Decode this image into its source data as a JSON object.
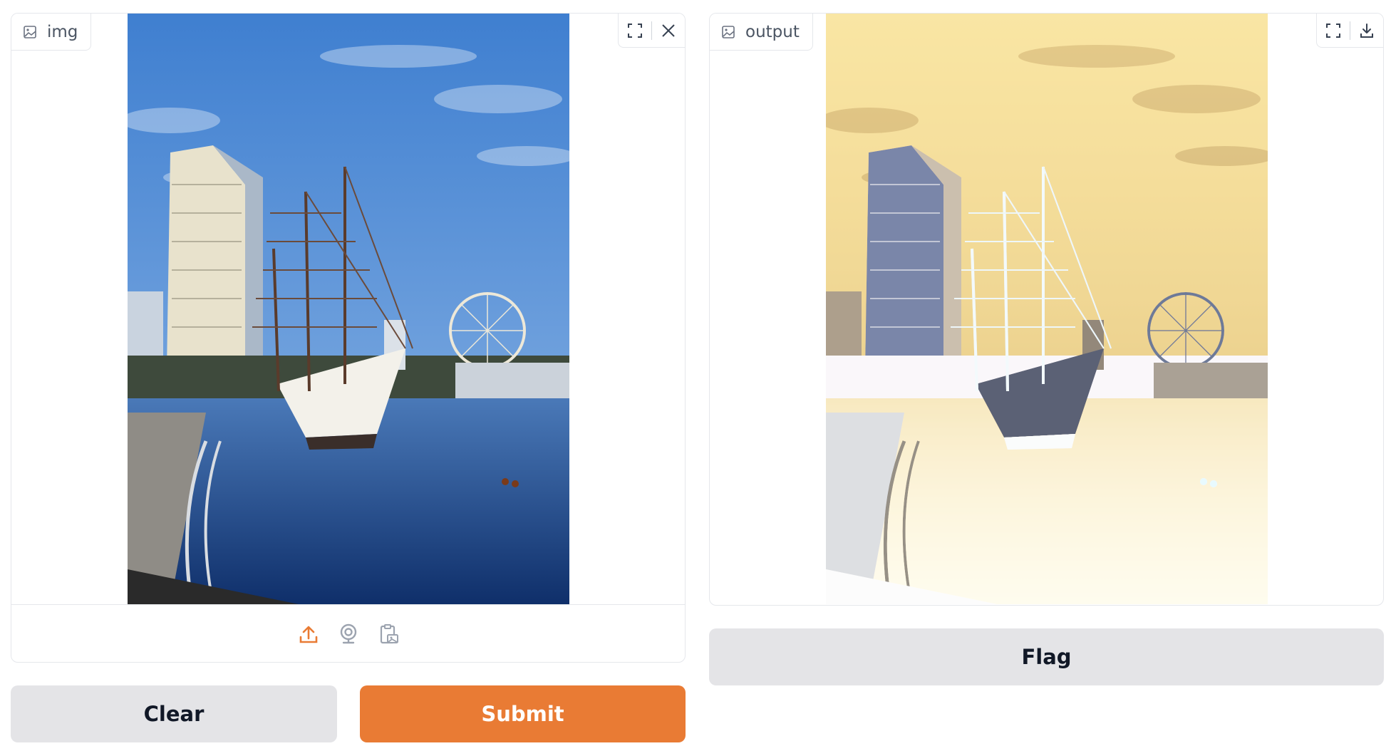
{
  "input": {
    "label": "img",
    "icons": [
      "image-icon",
      "fullscreen-icon",
      "close-icon"
    ],
    "sources": [
      "upload-icon",
      "webcam-icon",
      "clipboard-icon"
    ]
  },
  "output": {
    "label": "output",
    "icons": [
      "image-icon",
      "fullscreen-icon",
      "download-icon"
    ]
  },
  "buttons": {
    "clear": "Clear",
    "submit": "Submit",
    "flag": "Flag"
  },
  "colors": {
    "accent": "#e97b34",
    "secondary_button": "#e4e4e7",
    "border": "#e5e7eb",
    "label_text": "#4b5563"
  }
}
